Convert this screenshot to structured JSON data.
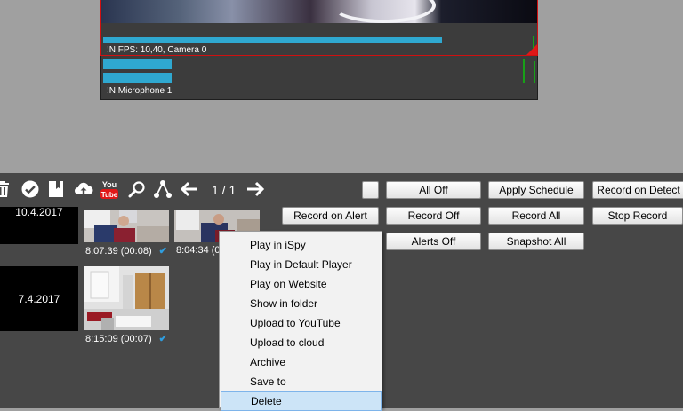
{
  "camera": {
    "status": "!N  FPS: 10,40, Camera 0",
    "level_fraction": 0.78
  },
  "microphone": {
    "status": "!N  Microphone 1"
  },
  "toolbar": {
    "icons": [
      "trash-icon",
      "check-circle-icon",
      "bookmark-icon",
      "upload-cloud-icon",
      "youtube-icon",
      "search-icon",
      "share-tree-icon",
      "arrow-left-icon",
      "arrow-right-icon"
    ],
    "page_indicator": "1 / 1",
    "youtube_label": "You"
  },
  "recordings": {
    "groups": [
      {
        "date": "10.4.2017",
        "clips": [
          {
            "time": "8:07:39 (00:08)",
            "checked": "✔"
          },
          {
            "time": "8:04:34 (0"
          }
        ]
      },
      {
        "date": "7.4.2017",
        "clips": [
          {
            "time": "8:15:09 (00:07)",
            "checked": "✔"
          }
        ]
      }
    ]
  },
  "controls": {
    "all_off": "All Off",
    "apply_schedule": "Apply Schedule",
    "record_on_detect": "Record on Detect",
    "record_on_alert": "Record on Alert",
    "record_off": "Record Off",
    "record_all": "Record All",
    "stop_record": "Stop Record",
    "alerts_off": "Alerts Off",
    "snapshot_all": "Snapshot All"
  },
  "context_menu": {
    "items": [
      "Play in iSpy",
      "Play in Default Player",
      "Play on Website",
      "Show in folder",
      "Upload to YouTube",
      "Upload to cloud",
      "Archive",
      "Save to",
      "Delete"
    ],
    "highlighted": "Delete"
  },
  "colors": {
    "level_bar": "#2fa8d0",
    "panel_bg": "#474747",
    "page_bg": "#a0a0a0",
    "alert_border": "#d01010",
    "check": "#2f9ee0",
    "menu_highlight": "#cce4f7"
  }
}
